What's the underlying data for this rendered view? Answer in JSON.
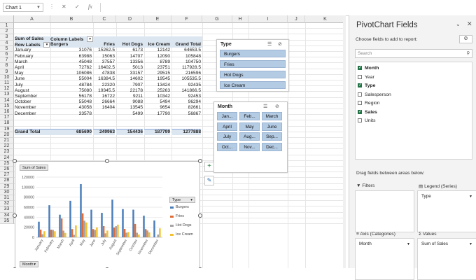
{
  "formula_bar": {
    "name_box": "Chart 1",
    "cancel_icon": "✕",
    "enter_icon": "✓",
    "function_icon": "fx"
  },
  "columns": [
    "A",
    "B",
    "C",
    "D",
    "E",
    "F",
    "G",
    "H",
    "I",
    "J",
    "K"
  ],
  "rows": [
    "1",
    "2",
    "3",
    "4",
    "5",
    "6",
    "7",
    "8",
    "9",
    "10",
    "11",
    "12",
    "13",
    "14",
    "15",
    "16",
    "17",
    "18",
    "19",
    "20",
    "21",
    "22",
    "23",
    "24",
    "25",
    "26",
    "27",
    "28",
    "29",
    "30",
    "31",
    "32",
    "33",
    "34",
    "35"
  ],
  "pivot": {
    "sum_label": "Sum of Sales",
    "column_labels": "Column Labels",
    "row_labels": "Row Labels",
    "headers": [
      "Burgers",
      "Fries",
      "Hot Dogs",
      "Ice Cream",
      "Grand Total"
    ],
    "rows": [
      {
        "month": "January",
        "v": [
          "31076",
          "15262.5",
          "6173",
          "12142",
          "64653.5"
        ]
      },
      {
        "month": "February",
        "v": [
          "63988",
          "15063",
          "14707",
          "12090",
          "105848"
        ]
      },
      {
        "month": "March",
        "v": [
          "45048",
          "37557",
          "13356",
          "8789",
          "104750"
        ]
      },
      {
        "month": "April",
        "v": [
          "72762",
          "16402.5",
          "5013",
          "23751",
          "117928.5"
        ]
      },
      {
        "month": "May",
        "v": [
          "106086",
          "47838",
          "33157",
          "29515",
          "216596"
        ]
      },
      {
        "month": "June",
        "v": [
          "55004",
          "16384.5",
          "14602",
          "19545",
          "105535.5"
        ]
      },
      {
        "month": "July",
        "v": [
          "48784",
          "22320",
          "7907",
          "13424",
          "92435"
        ]
      },
      {
        "month": "August",
        "v": [
          "75080",
          "19345.5",
          "22178",
          "25263",
          "141866.5"
        ]
      },
      {
        "month": "September",
        "v": [
          "56178",
          "16722",
          "9211",
          "10342",
          "92453"
        ]
      },
      {
        "month": "October",
        "v": [
          "55048",
          "26664",
          "9088",
          "5494",
          "96294"
        ]
      },
      {
        "month": "November",
        "v": [
          "43058",
          "16404",
          "13545",
          "9654",
          "82661"
        ]
      },
      {
        "month": "December",
        "v": [
          "33578",
          "",
          "5499",
          "17790",
          "56867"
        ]
      }
    ],
    "grand_label": "Grand Total",
    "grand": [
      "685690",
      "249963",
      "154436",
      "187799",
      "1277888"
    ]
  },
  "slicer_type": {
    "title": "Type",
    "items": [
      "Burgers",
      "Fries",
      "Hot Dogs",
      "Ice Cream"
    ]
  },
  "slicer_month": {
    "title": "Month",
    "items": [
      "Jan...",
      "Feb...",
      "March",
      "April",
      "May",
      "June",
      "July",
      "Aug...",
      "Sep...",
      "Oct...",
      "Nov...",
      "Dec..."
    ]
  },
  "chart": {
    "value_button": "Sum of Sales",
    "legend_button": "Type",
    "axis_button": "Month",
    "y_ticks": [
      "0",
      "20000",
      "40000",
      "60000",
      "80000",
      "100000",
      "120000"
    ],
    "colors": {
      "Burgers": "#4a7ebb",
      "Fries": "#e06c37",
      "Hot Dogs": "#a5a5a5",
      "Ice Cream": "#f2c230"
    }
  },
  "chart_data": {
    "type": "bar",
    "categories": [
      "January",
      "February",
      "March",
      "April",
      "May",
      "June",
      "July",
      "August",
      "September",
      "October",
      "November",
      "December"
    ],
    "series": [
      {
        "name": "Burgers",
        "values": [
          31076,
          63988,
          45048,
          72762,
          106086,
          55004,
          48784,
          75080,
          56178,
          55048,
          43058,
          33578
        ]
      },
      {
        "name": "Fries",
        "values": [
          15262.5,
          15063,
          37557,
          16402.5,
          47838,
          16384.5,
          22320,
          19345.5,
          16722,
          26664,
          16404,
          0
        ]
      },
      {
        "name": "Hot Dogs",
        "values": [
          6173,
          14707,
          13356,
          5013,
          33157,
          14602,
          7907,
          22178,
          9211,
          9088,
          13545,
          5499
        ]
      },
      {
        "name": "Ice Cream",
        "values": [
          12142,
          12090,
          8789,
          23751,
          29515,
          19545,
          13424,
          25263,
          10342,
          5494,
          9654,
          17790
        ]
      }
    ],
    "ylim": [
      0,
      120000
    ],
    "legend": "right"
  },
  "pane": {
    "title": "PivotChart Fields",
    "subtitle": "Choose fields to add to report:",
    "search_placeholder": "Search",
    "fields": [
      {
        "name": "Month",
        "checked": true
      },
      {
        "name": "Year",
        "checked": false
      },
      {
        "name": "Type",
        "checked": true
      },
      {
        "name": "Salesperson",
        "checked": false
      },
      {
        "name": "Region",
        "checked": false
      },
      {
        "name": "Sales",
        "checked": true
      },
      {
        "name": "Units",
        "checked": false
      }
    ],
    "drag_text": "Drag fields between areas below:",
    "filters_label": "Filters",
    "legend_label": "Legend (Series)",
    "legend_value": "Type",
    "axis_label": "Axis (Categories)",
    "axis_value": "Month",
    "values_label": "Values",
    "values_value": "Sum of Sales"
  }
}
